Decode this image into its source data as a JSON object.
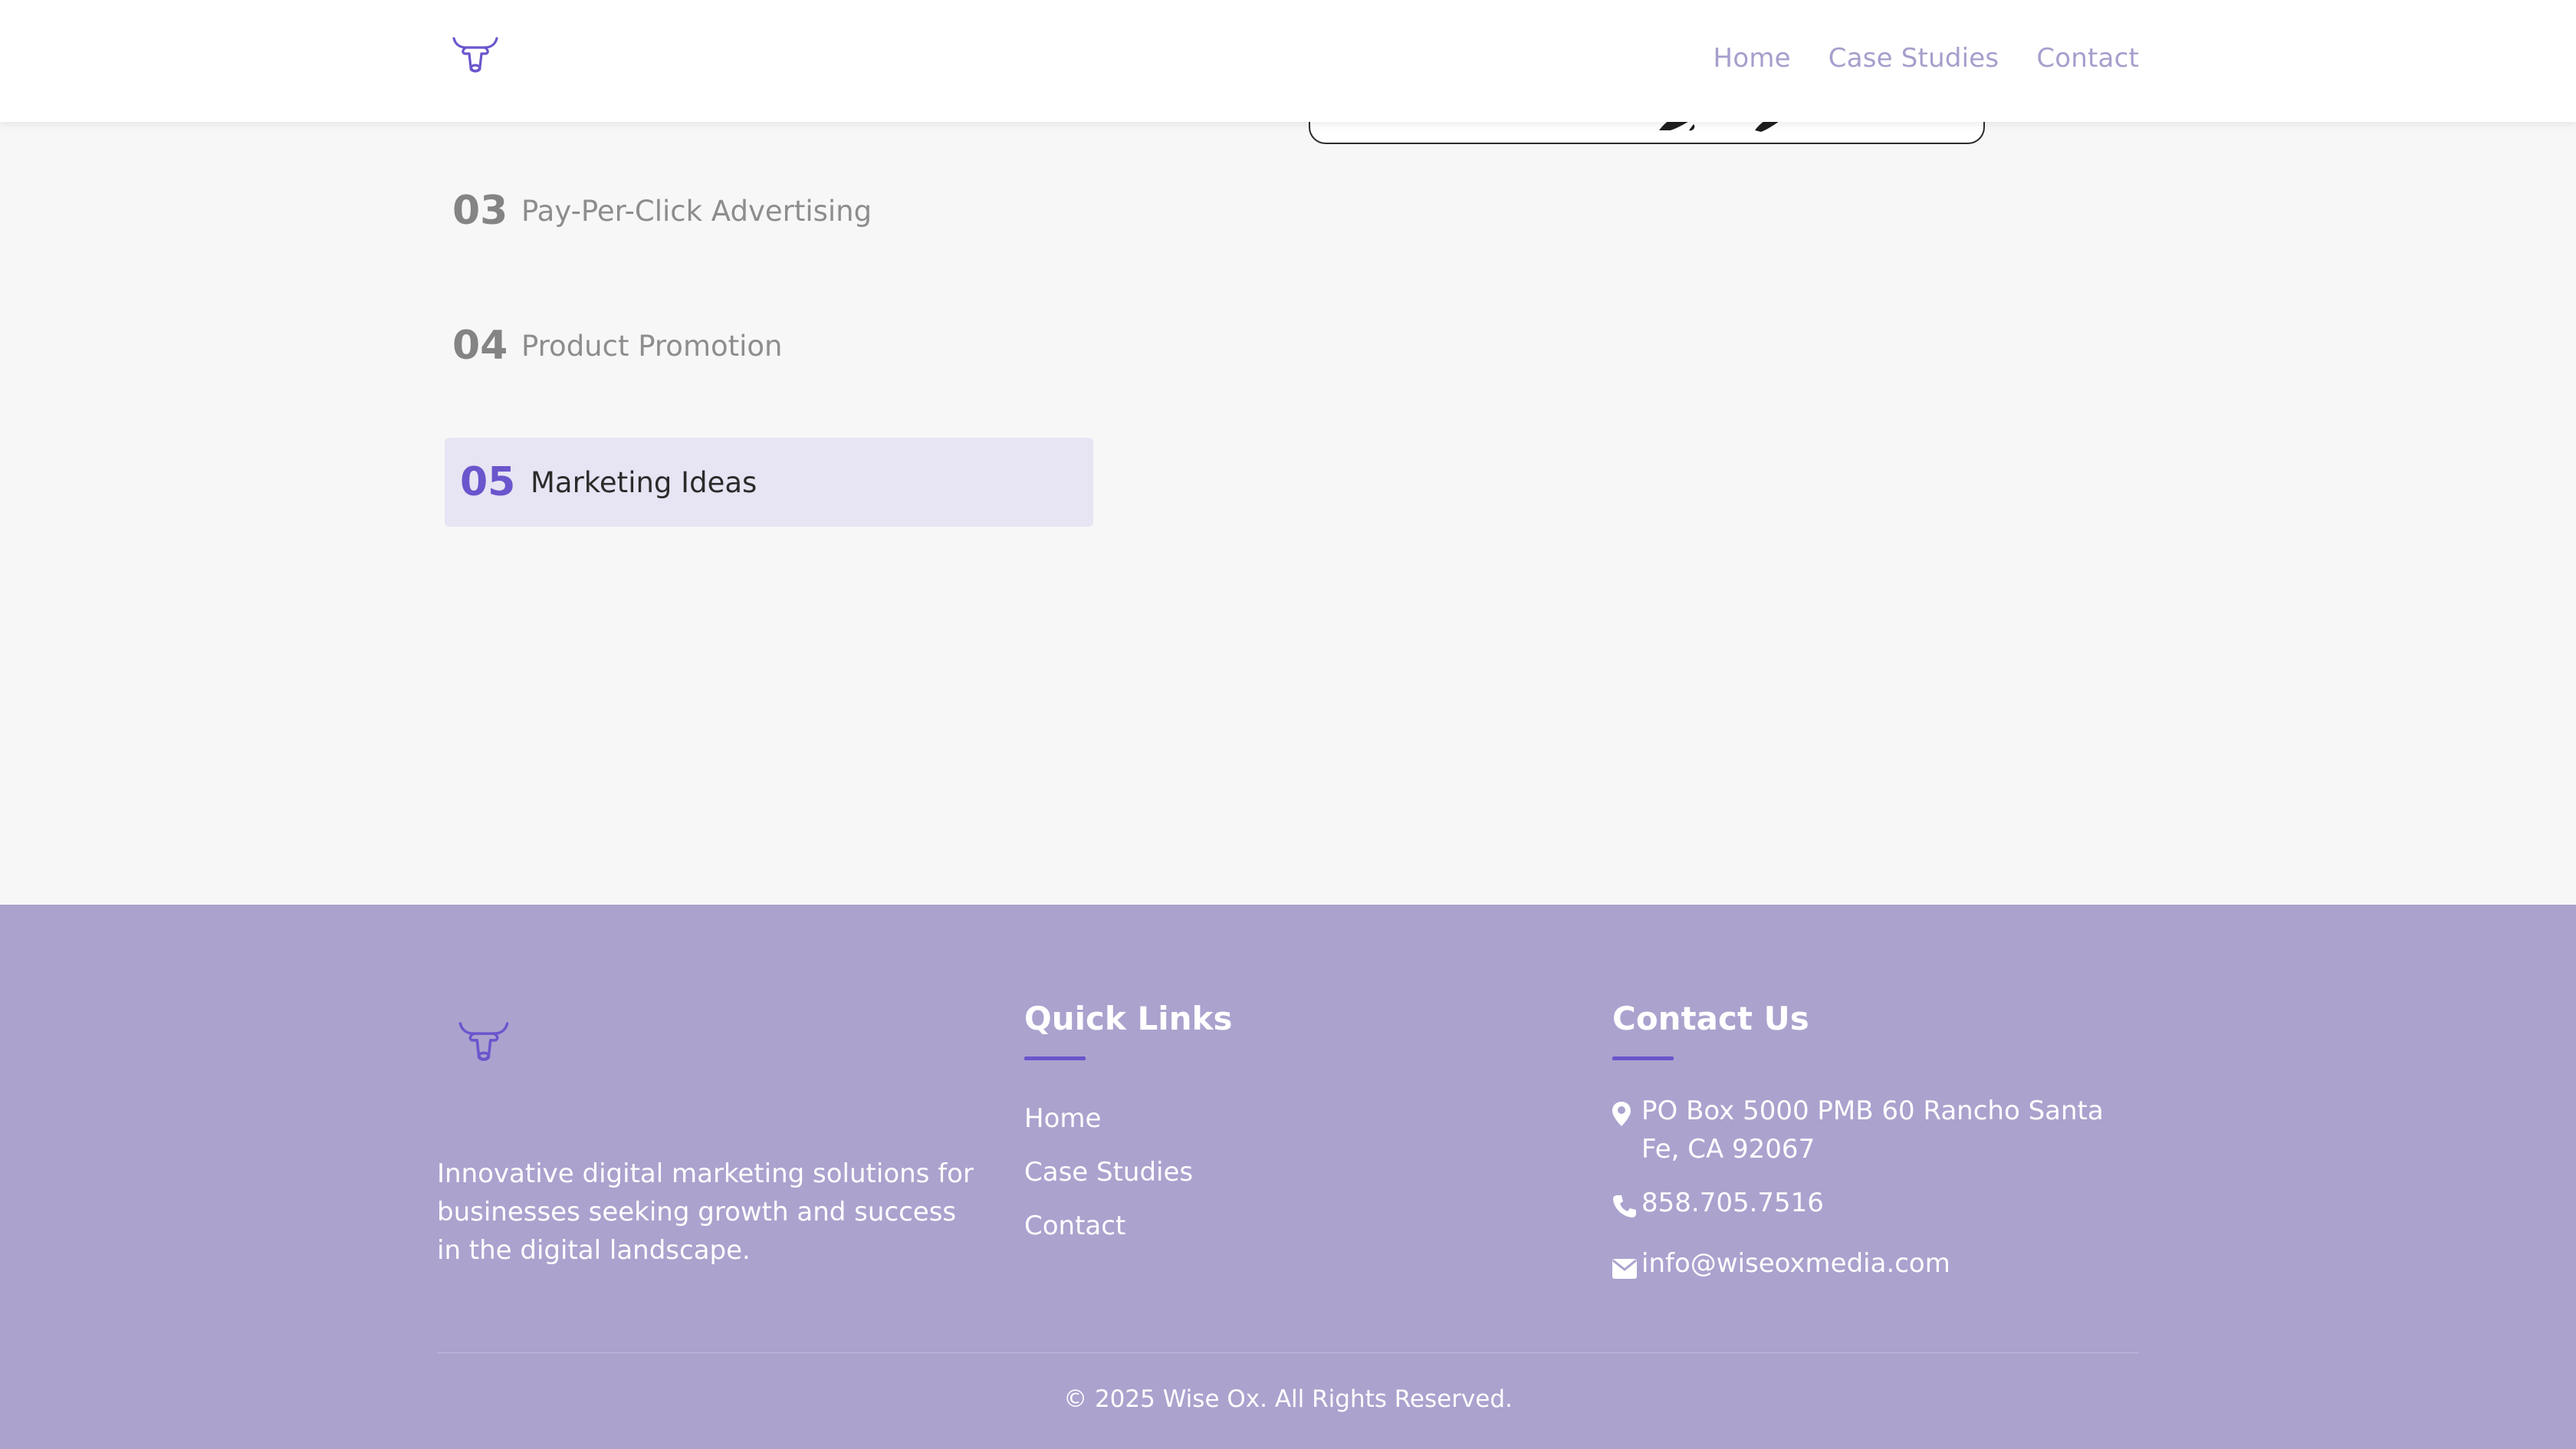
{
  "header": {
    "logo_icon": "ox-head-icon",
    "nav": [
      {
        "label": "Home"
      },
      {
        "label": "Case Studies"
      },
      {
        "label": "Contact"
      }
    ]
  },
  "services": [
    {
      "number": "03",
      "label": "Pay-Per-Click Advertising",
      "active": false
    },
    {
      "number": "04",
      "label": "Product Promotion",
      "active": false
    },
    {
      "number": "05",
      "label": "Marketing Ideas",
      "active": true
    }
  ],
  "footer": {
    "logo_icon": "ox-head-icon",
    "description": "Innovative digital marketing solutions for businesses seeking growth and success in the digital landscape.",
    "quick_links": {
      "title": "Quick Links",
      "links": [
        "Home",
        "Case Studies",
        "Contact"
      ]
    },
    "contact": {
      "title": "Contact Us",
      "address": "PO Box 5000 PMB 60 Rancho Santa Fe, CA 92067",
      "phone": "858.705.7516",
      "email": "info@wiseoxmedia.com"
    },
    "copyright": "© 2025 Wise Ox. All Rights Reserved."
  },
  "colors": {
    "accent": "#6b55cc",
    "nav_text": "#a59fcc",
    "footer_bg": "#aba2ce",
    "active_bg": "#e7e4f3",
    "page_bg": "#f7f7f7"
  }
}
